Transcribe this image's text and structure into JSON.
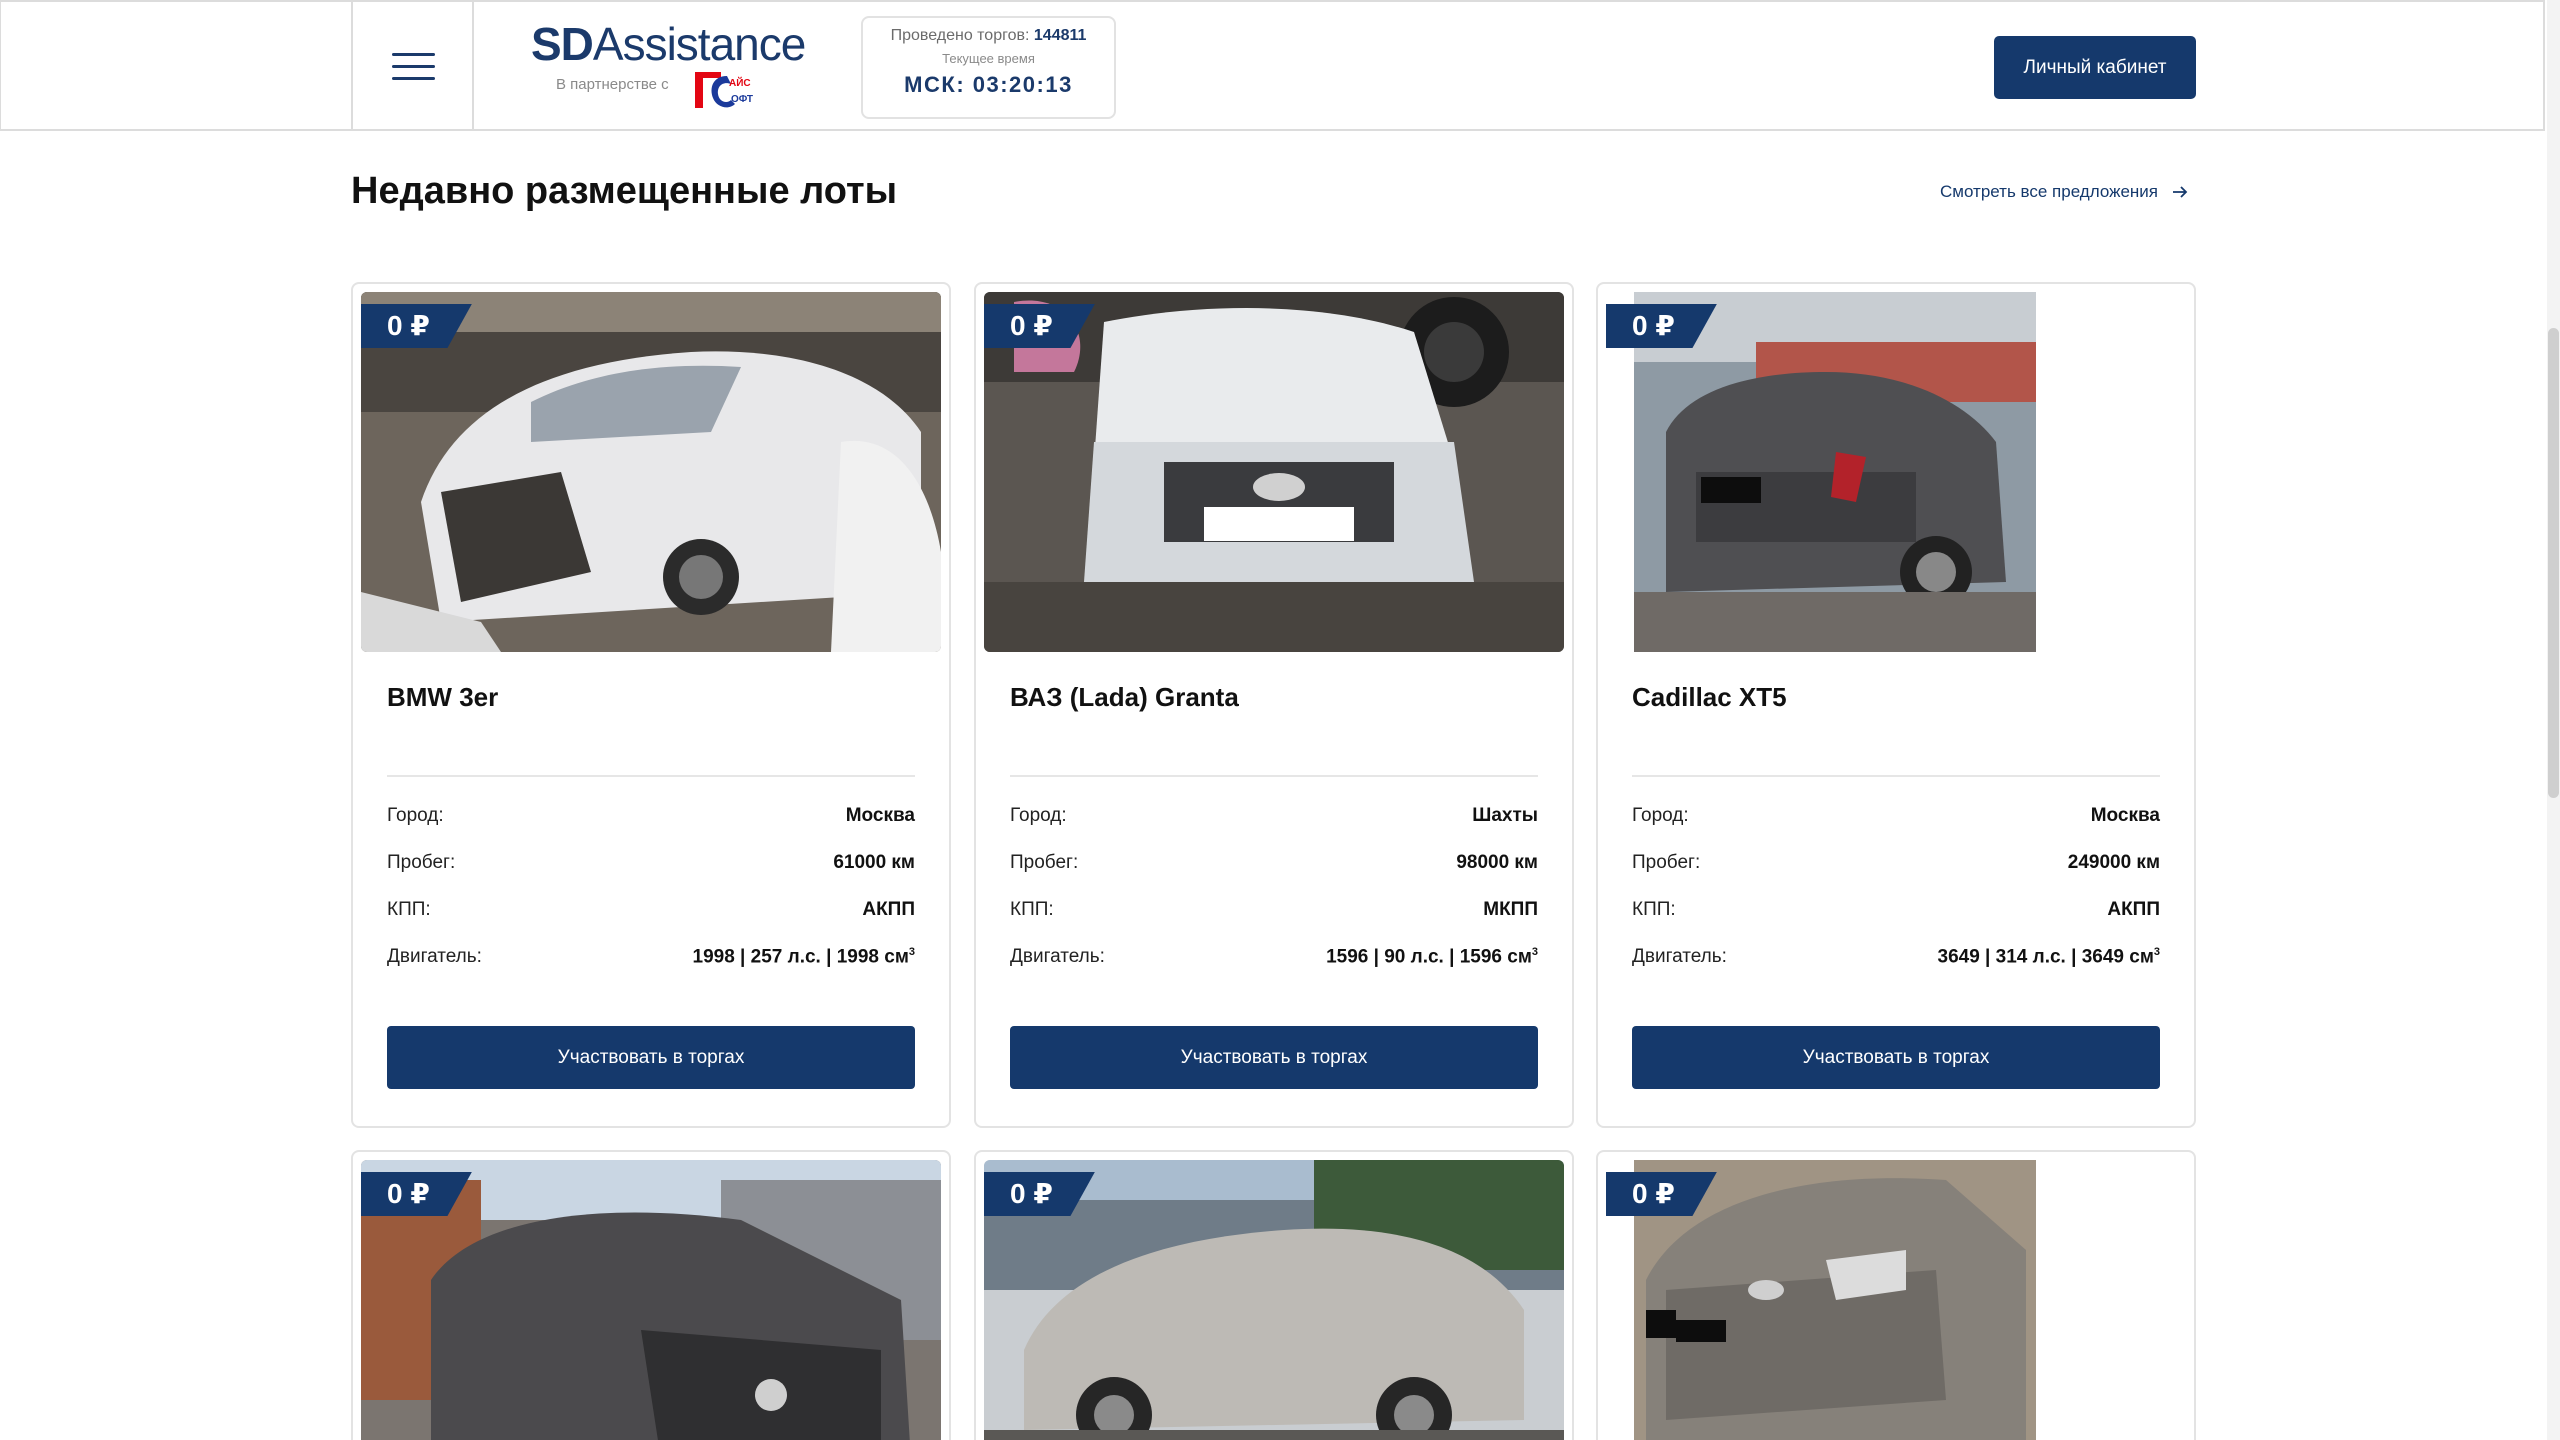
{
  "header": {
    "logo_bold": "SD",
    "logo_rest": "Assistance",
    "logo_partner": "В партнерстве с",
    "logo_badge_text": "АЙС ОФТ",
    "stats_label": "Проведено торгов:",
    "stats_count": "144811",
    "current_time_label": "Текущее время",
    "msk_time": "МСК: 03:20:13",
    "cabinet_button": "Личный кабинет"
  },
  "section": {
    "title": "Недавно размещенные лоты",
    "view_all": "Смотреть все предложения"
  },
  "labels": {
    "city": "Город:",
    "mileage": "Пробег:",
    "gearbox": "КПП:",
    "engine": "Двигатель:",
    "bid_button": "Участвовать в торгах",
    "engine_unit_sup": "3"
  },
  "cards": [
    {
      "price": "0 ₽",
      "title": "BMW 3er",
      "city": "Москва",
      "mileage": "61000 км",
      "gearbox": "АКПП",
      "engine": "1998 | 257 л.с. | 1998 см"
    },
    {
      "price": "0 ₽",
      "title": "ВАЗ (Lada) Granta",
      "city": "Шахты",
      "mileage": "98000 км",
      "gearbox": "МКПП",
      "engine": "1596 | 90 л.с. | 1596 см"
    },
    {
      "price": "0 ₽",
      "title": "Cadillac XT5",
      "city": "Москва",
      "mileage": "249000 км",
      "gearbox": "АКПП",
      "engine": "3649 | 314 л.с. | 3649 см"
    },
    {
      "price": "0 ₽"
    },
    {
      "price": "0 ₽"
    },
    {
      "price": "0 ₽"
    }
  ],
  "colors": {
    "brand": "#15396c",
    "badge_red": "#e30613"
  },
  "icons": [
    "menu-icon",
    "arrow-right-icon"
  ]
}
